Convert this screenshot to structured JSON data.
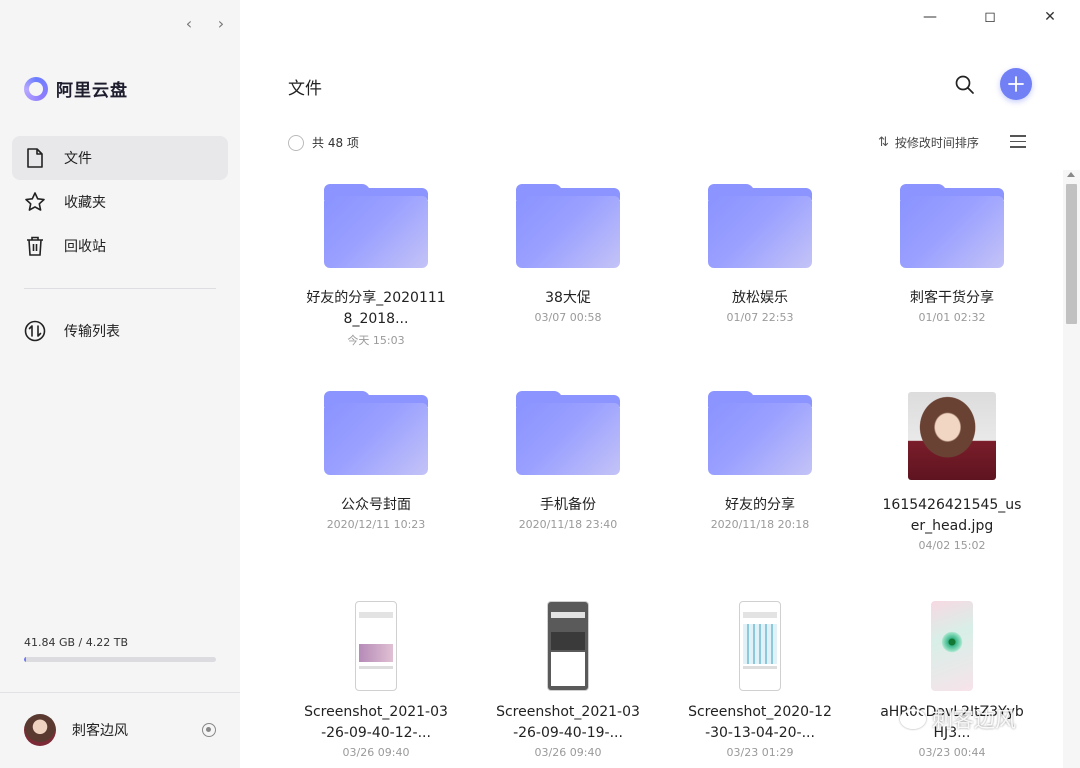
{
  "sidebar": {
    "logo_text": "阿里云盘",
    "menu": [
      {
        "label": "文件",
        "icon": "file-icon",
        "active": true
      },
      {
        "label": "收藏夹",
        "icon": "star-icon",
        "active": false
      },
      {
        "label": "回收站",
        "icon": "trash-icon",
        "active": false
      }
    ],
    "transfer_label": "传输列表",
    "storage": {
      "text": "41.84 GB / 4.22 TB",
      "used_fraction": 0.0097
    },
    "user": {
      "name": "刺客边风"
    }
  },
  "main": {
    "title": "文件",
    "count_text": "共 48 项",
    "sort_label": "按修改时间排序",
    "files": [
      {
        "name": "好友的分享_20201118_2018...",
        "date": "今天 15:03",
        "kind": "folder"
      },
      {
        "name": "38大促",
        "date": "03/07 00:58",
        "kind": "folder"
      },
      {
        "name": "放松娱乐",
        "date": "01/07 22:53",
        "kind": "folder"
      },
      {
        "name": "刺客干货分享",
        "date": "01/01 02:32",
        "kind": "folder"
      },
      {
        "name": "公众号封面",
        "date": "2020/12/11 10:23",
        "kind": "folder"
      },
      {
        "name": "手机备份",
        "date": "2020/11/18 23:40",
        "kind": "folder"
      },
      {
        "name": "好友的分享",
        "date": "2020/11/18 20:18",
        "kind": "folder"
      },
      {
        "name": "1615426421545_user_head.jpg",
        "date": "04/02 15:02",
        "kind": "photo"
      },
      {
        "name": "Screenshot_2021-03-26-09-40-12-...",
        "date": "03/26 09:40",
        "kind": "phone"
      },
      {
        "name": "Screenshot_2021-03-26-09-40-19-...",
        "date": "03/26 09:40",
        "kind": "phone-dark"
      },
      {
        "name": "Screenshot_2020-12-30-13-04-20-...",
        "date": "03/23 01:29",
        "kind": "phone-chart"
      },
      {
        "name": "aHR0cDovL2ItZ3YybHJ3...",
        "date": "03/23 00:44",
        "kind": "phone-eye"
      }
    ]
  },
  "watermark": {
    "text": "刺客边风"
  },
  "colors": {
    "accent": "#7180f5",
    "folder": "#8c95ff",
    "sidebar_bg": "#f5f5f6"
  }
}
